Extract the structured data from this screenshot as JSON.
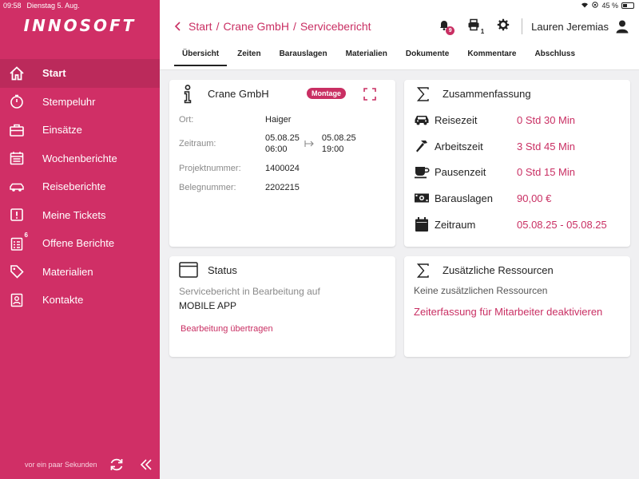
{
  "status_bar": {
    "time": "09:58",
    "date": "Dienstag 5. Aug.",
    "battery": "45 %",
    "battery_level": 0.45
  },
  "app": {
    "logo": "INNOSOFT"
  },
  "sidebar": {
    "items": [
      {
        "label": "Start",
        "icon": "home-icon",
        "active": true
      },
      {
        "label": "Stempeluhr",
        "icon": "stopwatch-icon"
      },
      {
        "label": "Einsätze",
        "icon": "briefcase-icon"
      },
      {
        "label": "Wochenberichte",
        "icon": "calendar-icon"
      },
      {
        "label": "Reiseberichte",
        "icon": "car-icon"
      },
      {
        "label": "Meine Tickets",
        "icon": "ticket-alert-icon"
      },
      {
        "label": "Offene Berichte",
        "icon": "clipboard-list-icon",
        "badge": "6"
      },
      {
        "label": "Materialien",
        "icon": "tag-icon"
      },
      {
        "label": "Kontakte",
        "icon": "contact-icon"
      }
    ],
    "sync_text": "vor ein paar Sekunden"
  },
  "header": {
    "breadcrumb": [
      "Start",
      "/",
      "Crane GmbH",
      "/",
      "Servicebericht"
    ],
    "notifications_count": "9",
    "print_count": "1",
    "user_name": "Lauren Jeremias",
    "tabs": [
      "Übersicht",
      "Zeiten",
      "Barauslagen",
      "Materialien",
      "Dokumente",
      "Kommentare",
      "Abschluss"
    ],
    "active_tab": "Übersicht"
  },
  "project": {
    "title": "Crane GmbH",
    "badge": "Montage",
    "ort_label": "Ort:",
    "ort": "Haiger",
    "zeitraum_label": "Zeitraum:",
    "start_date": "05.08.25",
    "start_time": "06:00",
    "end_date": "05.08.25",
    "end_time": "19:00",
    "projektnummer_label": "Projektnummer:",
    "projektnummer": "1400024",
    "belegnummer_label": "Belegnummer:",
    "belegnummer": "2202215"
  },
  "summary": {
    "title": "Zusammenfassung",
    "rows": [
      {
        "label": "Reisezeit",
        "value": "0 Std 30 Min",
        "icon": "car-icon"
      },
      {
        "label": "Arbeitszeit",
        "value": "3 Std 45 Min",
        "icon": "hammer-icon"
      },
      {
        "label": "Pausenzeit",
        "value": "0 Std 15 Min",
        "icon": "coffee-cup-icon"
      },
      {
        "label": "Barauslagen",
        "value": "90,00 €",
        "icon": "banknote-icon"
      },
      {
        "label": "Zeitraum",
        "value": "05.08.25 - 05.08.25",
        "icon": "calendar-icon"
      }
    ]
  },
  "status": {
    "title": "Status",
    "line1": "Servicebericht in Bearbeitung auf",
    "line2": "MOBILE APP",
    "link": "Bearbeitung übertragen"
  },
  "resources": {
    "title": "Zusätzliche Ressourcen",
    "text": "Keine zusätzlichen Ressourcen",
    "link": "Zeiterfassung für Mitarbeiter deaktivieren"
  },
  "colors": {
    "brand": "#d02f66",
    "accent": "#c92f63"
  }
}
